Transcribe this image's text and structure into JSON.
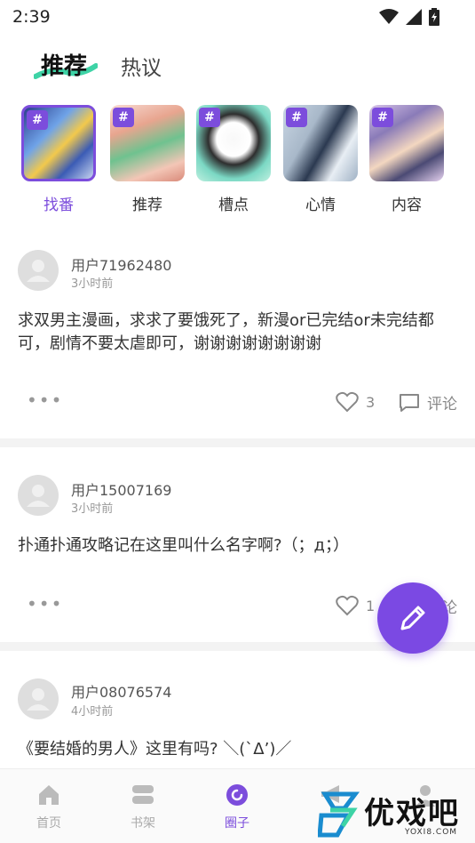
{
  "status_bar": {
    "time": "2:39"
  },
  "top_tabs": {
    "active": "推荐",
    "inactive": "热议"
  },
  "categories": [
    {
      "label": "找番",
      "active": true,
      "hash": "#"
    },
    {
      "label": "推荐",
      "active": false,
      "hash": "#"
    },
    {
      "label": "槽点",
      "active": false,
      "hash": "#"
    },
    {
      "label": "心情",
      "active": false,
      "hash": "#"
    },
    {
      "label": "内容",
      "active": false,
      "hash": "#"
    }
  ],
  "posts": [
    {
      "username": "用户71962480",
      "time": "3小时前",
      "content": "求双男主漫画，求求了要饿死了，新漫or已完结or未完结都可，剧情不要太虐即可，谢谢谢谢谢谢谢谢",
      "more": "•••",
      "likes": "3",
      "comment_label": "评论"
    },
    {
      "username": "用户15007169",
      "time": "3小时前",
      "content": "扑通扑通攻略记在这里叫什么名字啊?（；д；）",
      "more": "•••",
      "likes": "1",
      "comment_label": "评论"
    },
    {
      "username": "用户08076574",
      "time": "4小时前",
      "content": "《要结婚的男人》这里有吗? ＼(`Δ’)／"
    }
  ],
  "bottom_nav": [
    {
      "label": "首页",
      "active": false
    },
    {
      "label": "书架",
      "active": false
    },
    {
      "label": "圈子",
      "active": true
    },
    {
      "label": "",
      "active": false
    },
    {
      "label": "",
      "active": false
    }
  ],
  "watermark": {
    "text": "优戏吧",
    "url": "YOXI8.COM"
  },
  "colors": {
    "accent": "#7c4ddc",
    "fab": "#7b49e3",
    "divider": "#f3f3f3"
  }
}
